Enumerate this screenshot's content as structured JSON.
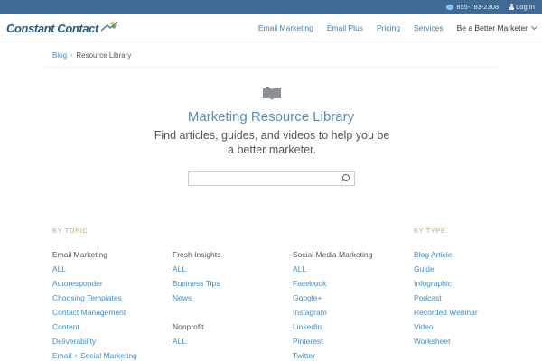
{
  "utility": {
    "phone": "855-783-2308",
    "login": "Log In"
  },
  "header": {
    "logo": "Constant Contact",
    "nav": [
      "Email Marketing",
      "Email Plus",
      "Pricing",
      "Services"
    ],
    "nav_dropdown": "Be a Better Marketer"
  },
  "breadcrumb": {
    "blog": "Blog",
    "current": "Resource Library"
  },
  "hero": {
    "title": "Marketing Resource Library",
    "subtitle": "Find articles, guides, and videos to help you be a better marketer."
  },
  "search": {
    "value": ""
  },
  "topic": {
    "label": "BY TOPIC",
    "columns": [
      {
        "groups": [
          {
            "heading": "Email Marketing",
            "links": [
              "ALL",
              "Autoresponder",
              "Choosing Templates",
              "Contact Management",
              "Content",
              "Deliverability",
              "Email + Social Marketing"
            ]
          }
        ]
      },
      {
        "groups": [
          {
            "heading": "Fresh Insights",
            "links": [
              "ALL",
              "Business Tips",
              "News"
            ]
          },
          {
            "heading": "Nonprofit",
            "links": [
              "ALL"
            ]
          }
        ]
      },
      {
        "groups": [
          {
            "heading": "Social Media Marketing",
            "links": [
              "ALL",
              "Facebook",
              "Google+",
              "Instagram",
              "LinkedIn",
              "Pinterest",
              "Twitter"
            ]
          }
        ]
      }
    ]
  },
  "type": {
    "label": "BY TYPE",
    "links": [
      "Blog Article",
      "Guide",
      "Infographic",
      "Podcast",
      "Recorded Webinar",
      "Video",
      "Worksheet"
    ]
  },
  "icons": {
    "hero": "open-book-icon",
    "search": "search-icon",
    "phone": "chat-bubble-icon",
    "login": "person-icon"
  }
}
